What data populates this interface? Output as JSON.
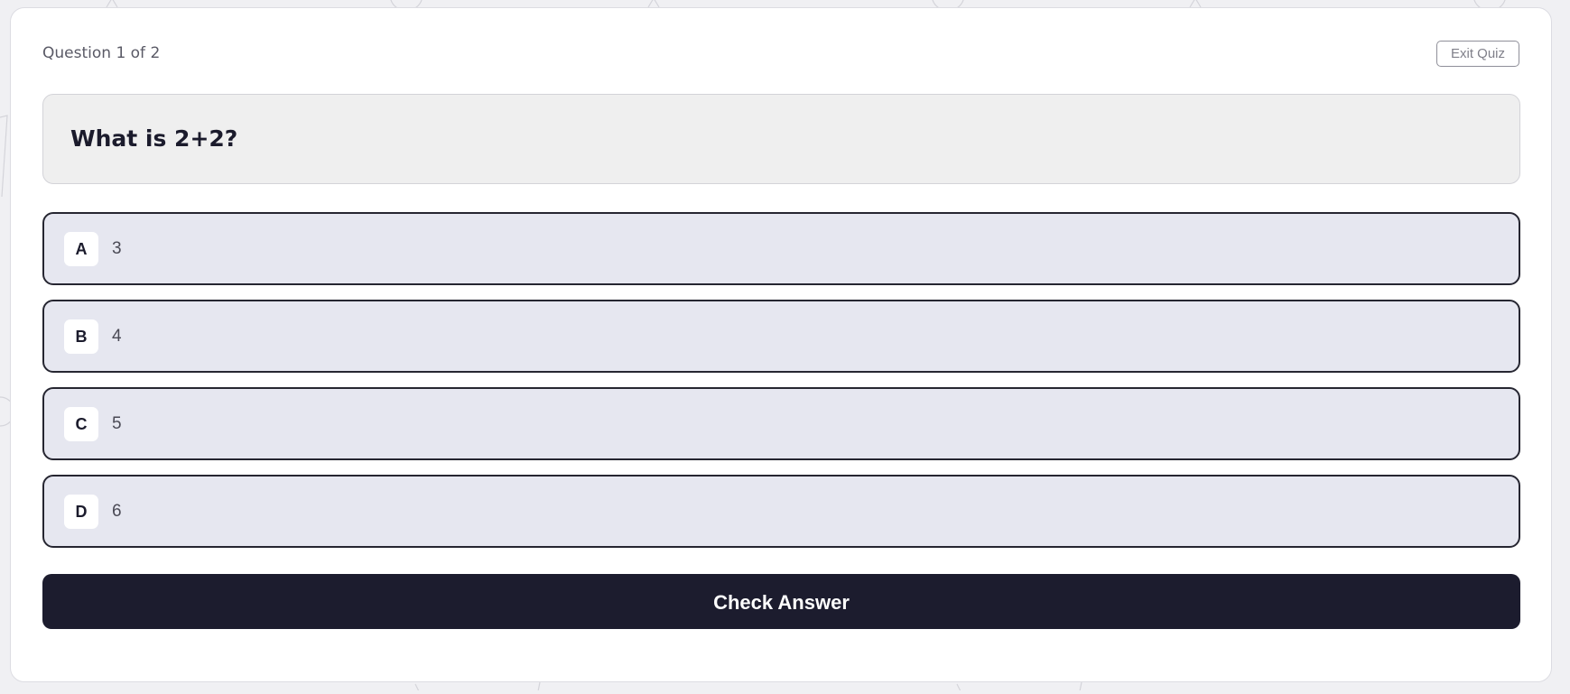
{
  "quiz": {
    "progress_label": "Question 1 of 2",
    "exit_label": "Exit Quiz",
    "question": "What is 2+2?",
    "options": [
      {
        "letter": "A",
        "text": "3"
      },
      {
        "letter": "B",
        "text": "4"
      },
      {
        "letter": "C",
        "text": "5"
      },
      {
        "letter": "D",
        "text": "6"
      }
    ],
    "submit_label": "Check Answer"
  },
  "colors": {
    "page_background": "#f0f0f3",
    "option_background": "#e6e7f0",
    "option_border": "#262631",
    "primary_button": "#1c1c2e",
    "question_background": "#efefef"
  }
}
